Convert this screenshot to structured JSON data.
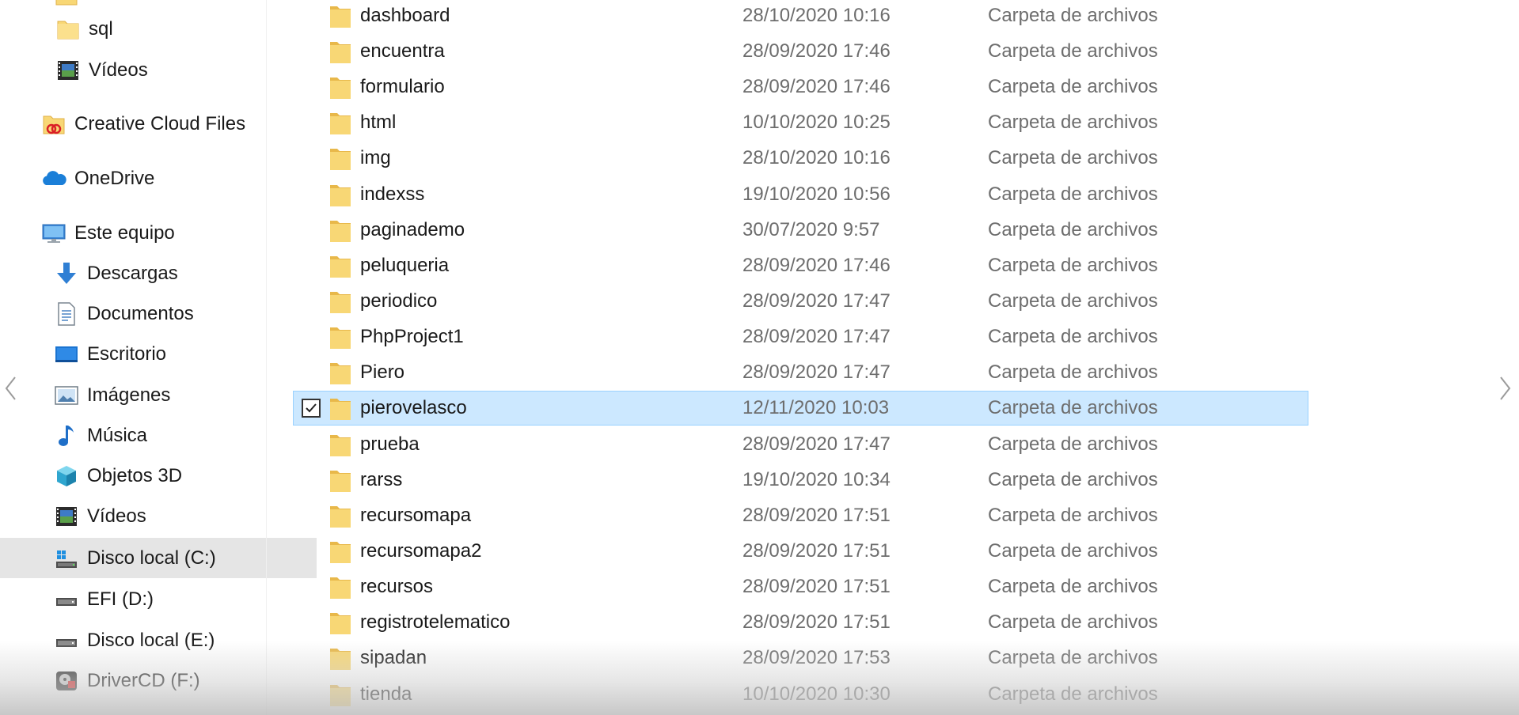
{
  "sidebar": {
    "items": [
      {
        "label": "sql",
        "icon": "folder-icon"
      },
      {
        "label": "Vídeos",
        "icon": "videos-icon"
      },
      {
        "label": "Creative Cloud Files",
        "icon": "creative-cloud-icon"
      },
      {
        "label": "OneDrive",
        "icon": "onedrive-icon"
      },
      {
        "label": "Este equipo",
        "icon": "computer-icon"
      },
      {
        "label": "Descargas",
        "icon": "downloads-icon"
      },
      {
        "label": "Documentos",
        "icon": "documents-icon"
      },
      {
        "label": "Escritorio",
        "icon": "desktop-icon"
      },
      {
        "label": "Imágenes",
        "icon": "pictures-icon"
      },
      {
        "label": "Música",
        "icon": "music-icon"
      },
      {
        "label": "Objetos 3D",
        "icon": "objects-3d-icon"
      },
      {
        "label": "Vídeos",
        "icon": "videos-icon"
      },
      {
        "label": "Disco local (C:)",
        "icon": "drive-c-icon",
        "selected": true
      },
      {
        "label": "EFI (D:)",
        "icon": "drive-icon"
      },
      {
        "label": "Disco local (E:)",
        "icon": "drive-icon"
      },
      {
        "label": "DriverCD (F:)",
        "icon": "driver-cd-icon"
      }
    ]
  },
  "files": [
    {
      "name": "dashboard",
      "date": "28/10/2020 10:16",
      "type": "Carpeta de archivos"
    },
    {
      "name": "encuentra",
      "date": "28/09/2020 17:46",
      "type": "Carpeta de archivos"
    },
    {
      "name": "formulario",
      "date": "28/09/2020 17:46",
      "type": "Carpeta de archivos"
    },
    {
      "name": "html",
      "date": "10/10/2020 10:25",
      "type": "Carpeta de archivos"
    },
    {
      "name": "img",
      "date": "28/10/2020 10:16",
      "type": "Carpeta de archivos"
    },
    {
      "name": "indexss",
      "date": "19/10/2020 10:56",
      "type": "Carpeta de archivos"
    },
    {
      "name": "paginademo",
      "date": "30/07/2020 9:57",
      "type": "Carpeta de archivos"
    },
    {
      "name": "peluqueria",
      "date": "28/09/2020 17:46",
      "type": "Carpeta de archivos"
    },
    {
      "name": "periodico",
      "date": "28/09/2020 17:47",
      "type": "Carpeta de archivos"
    },
    {
      "name": "PhpProject1",
      "date": "28/09/2020 17:47",
      "type": "Carpeta de archivos"
    },
    {
      "name": "Piero",
      "date": "28/09/2020 17:47",
      "type": "Carpeta de archivos"
    },
    {
      "name": "pierovelasco",
      "date": "12/11/2020 10:03",
      "type": "Carpeta de archivos",
      "selected": true
    },
    {
      "name": "prueba",
      "date": "28/09/2020 17:47",
      "type": "Carpeta de archivos"
    },
    {
      "name": "rarss",
      "date": "19/10/2020 10:34",
      "type": "Carpeta de archivos"
    },
    {
      "name": "recursomapa",
      "date": "28/09/2020 17:51",
      "type": "Carpeta de archivos"
    },
    {
      "name": "recursomapa2",
      "date": "28/09/2020 17:51",
      "type": "Carpeta de archivos"
    },
    {
      "name": "recursos",
      "date": "28/09/2020 17:51",
      "type": "Carpeta de archivos"
    },
    {
      "name": "registrotelematico",
      "date": "28/09/2020 17:51",
      "type": "Carpeta de archivos"
    },
    {
      "name": "sipadan",
      "date": "28/09/2020 17:53",
      "type": "Carpeta de archivos"
    },
    {
      "name": "tienda",
      "date": "10/10/2020 10:30",
      "type": "Carpeta de archivos"
    }
  ],
  "colors": {
    "folder": "#f8d775",
    "folder_dark": "#e8b84a",
    "selection_bg": "#cce8ff",
    "selection_border": "#99d1ff",
    "sidebar_selected": "#e5e5e5",
    "meta_text": "#6d6d6d"
  }
}
